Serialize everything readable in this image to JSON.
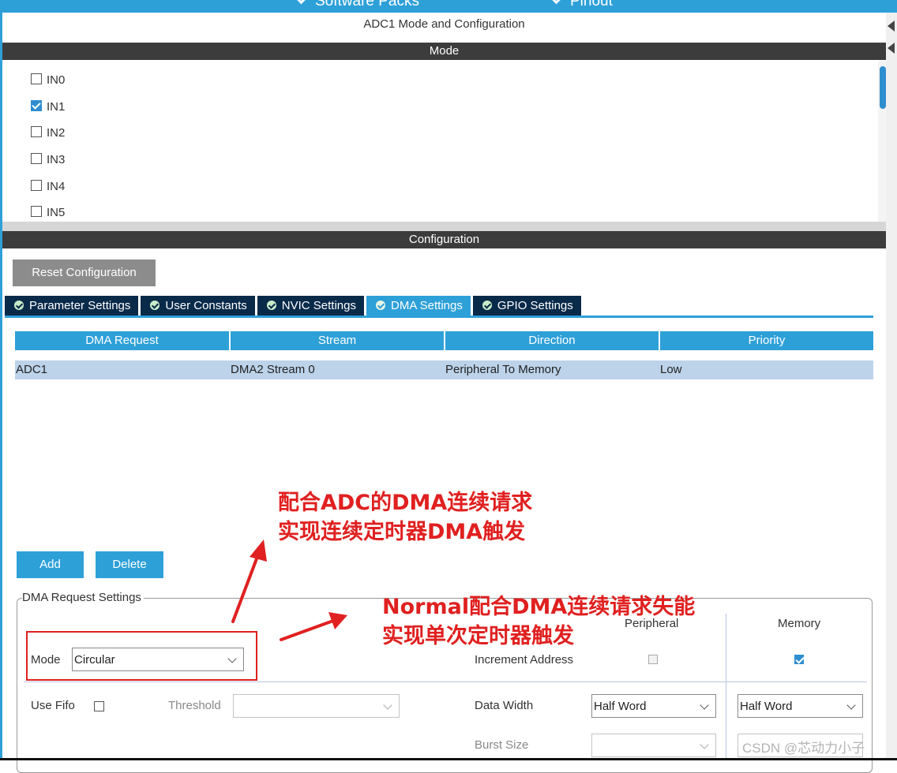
{
  "header": {
    "nav_items": [
      "Software Packs",
      "Pinout"
    ]
  },
  "panel": {
    "title": "ADC1 Mode and Configuration",
    "mode_section": "Mode",
    "config_section": "Configuration"
  },
  "mode_channels": [
    {
      "label": "IN0",
      "checked": false
    },
    {
      "label": "IN1",
      "checked": true
    },
    {
      "label": "IN2",
      "checked": false
    },
    {
      "label": "IN3",
      "checked": false
    },
    {
      "label": "IN4",
      "checked": false
    },
    {
      "label": "IN5",
      "checked": false
    }
  ],
  "reset_button": "Reset Configuration",
  "tabs": [
    {
      "label": "Parameter Settings",
      "active": false
    },
    {
      "label": "User Constants",
      "active": false
    },
    {
      "label": "NVIC Settings",
      "active": false
    },
    {
      "label": "DMA Settings",
      "active": true
    },
    {
      "label": "GPIO Settings",
      "active": false
    }
  ],
  "dma_table": {
    "columns": [
      "DMA Request",
      "Stream",
      "Direction",
      "Priority"
    ],
    "rows": [
      [
        "ADC1",
        "DMA2 Stream 0",
        "Peripheral To Memory",
        "Low"
      ]
    ]
  },
  "buttons": {
    "add": "Add",
    "delete": "Delete"
  },
  "request_settings": {
    "legend": "DMA Request Settings",
    "mode_label": "Mode",
    "mode_value": "Circular",
    "use_fifo_label": "Use Fifo",
    "use_fifo_checked": false,
    "threshold_label": "Threshold",
    "threshold_value": "",
    "peripheral_header": "Peripheral",
    "memory_header": "Memory",
    "increment_address_label": "Increment Address",
    "peripheral_increment": false,
    "memory_increment": true,
    "data_width_label": "Data Width",
    "peripheral_data_width": "Half Word",
    "memory_data_width": "Half Word",
    "burst_size_label": "Burst Size",
    "peripheral_burst_size": "",
    "memory_burst_size": ""
  },
  "annotations": {
    "note1_line1": "配合ADC的DMA连续请求",
    "note1_line2": "实现连续定时器DMA触发",
    "note2_line1": "Normal配合DMA连续请求失能",
    "note2_line2": "实现单次定时器触发",
    "color": "#e02020"
  },
  "watermark": "CSDN @芯动力小子",
  "colors": {
    "accent": "#2ea0d8",
    "tab_dark": "#0a2a4a",
    "section_bar": "#3c3c3c",
    "selected_row": "#bcd3ea"
  }
}
